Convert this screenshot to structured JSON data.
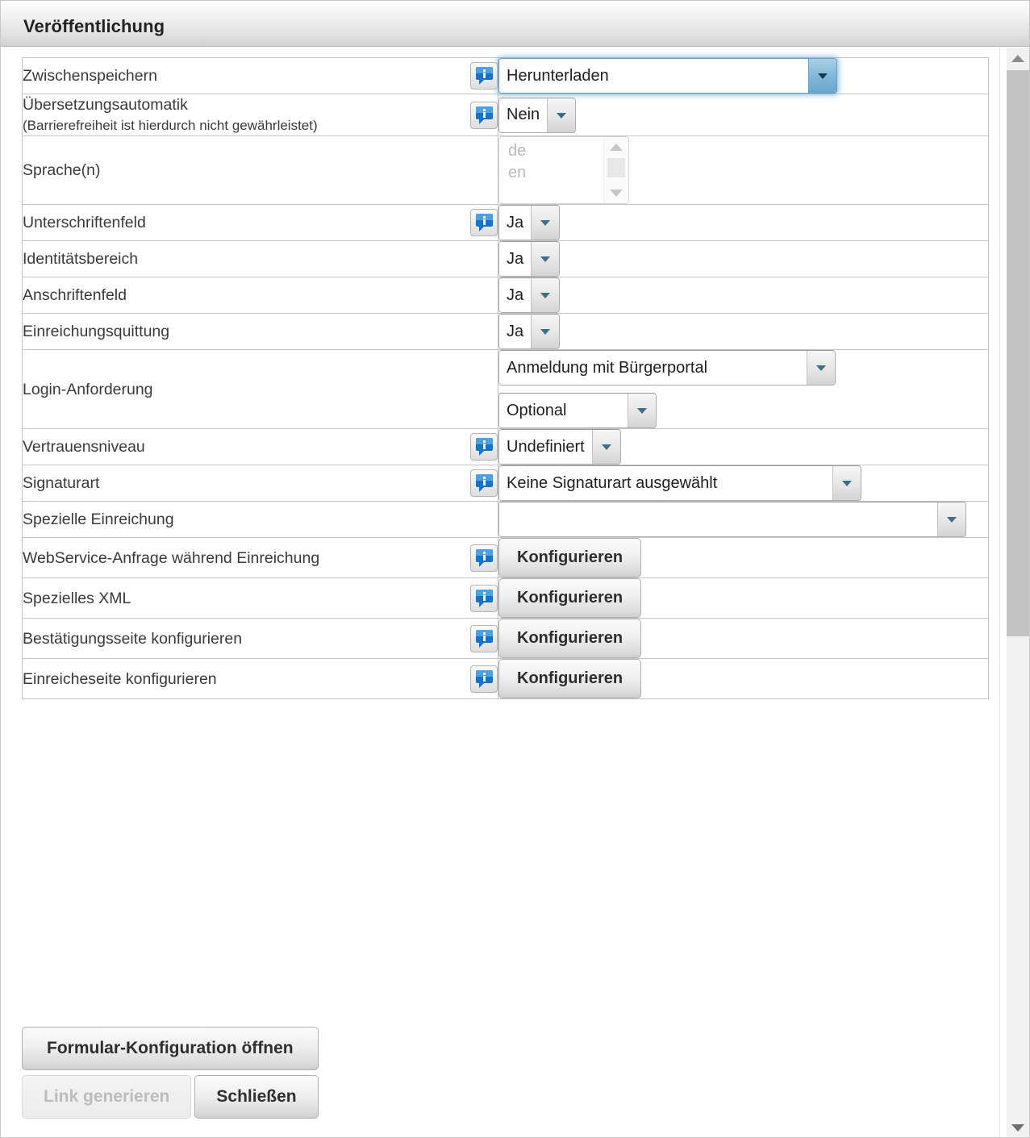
{
  "window": {
    "title": "Veröffentlichung"
  },
  "rows": [
    {
      "label": "Zwischenspeichern",
      "sublabel": "",
      "has_info": true,
      "control": "select",
      "value": "Herunterladen",
      "focused": true
    },
    {
      "label": "Übersetzungsautomatik",
      "sublabel": "(Barrierefreiheit ist hierdurch nicht gewährleistet)",
      "has_info": true,
      "control": "select",
      "value": "Nein",
      "focused": false
    },
    {
      "label": "Sprache(n)",
      "sublabel": "",
      "has_info": false,
      "control": "listbox",
      "options": [
        "de",
        "en"
      ]
    },
    {
      "label": "Unterschriftenfeld",
      "sublabel": "",
      "has_info": true,
      "control": "select",
      "value": "Ja",
      "focused": false
    },
    {
      "label": "Identitätsbereich",
      "sublabel": "",
      "has_info": false,
      "control": "select",
      "value": "Ja",
      "focused": false
    },
    {
      "label": "Anschriftenfeld",
      "sublabel": "",
      "has_info": false,
      "control": "select",
      "value": "Ja",
      "focused": false
    },
    {
      "label": "Einreichungsquittung",
      "sublabel": "",
      "has_info": false,
      "control": "select",
      "value": "Ja",
      "focused": false
    },
    {
      "label": "Login-Anforderung",
      "sublabel": "",
      "has_info": false,
      "control": "select-pair",
      "value": "Anmeldung mit Bürgerportal",
      "value2": "Optional"
    },
    {
      "label": "Vertrauensniveau",
      "sublabel": "",
      "has_info": true,
      "control": "select",
      "value": "Undefiniert",
      "focused": false
    },
    {
      "label": "Signaturart",
      "sublabel": "",
      "has_info": true,
      "control": "select",
      "value": "Keine Signaturart ausgewählt",
      "focused": false
    },
    {
      "label": "Spezielle Einreichung",
      "sublabel": "",
      "has_info": false,
      "control": "select",
      "value": "",
      "focused": false
    },
    {
      "label": "WebService-Anfrage während Einreichung",
      "sublabel": "",
      "has_info": true,
      "control": "button",
      "value": "Konfigurieren"
    },
    {
      "label": "Spezielles XML",
      "sublabel": "",
      "has_info": true,
      "control": "button",
      "value": "Konfigurieren"
    },
    {
      "label": "Bestätigungsseite konfigurieren",
      "sublabel": "",
      "has_info": true,
      "control": "button",
      "value": "Konfigurieren"
    },
    {
      "label": "Einreicheseite konfigurieren",
      "sublabel": "",
      "has_info": true,
      "control": "button",
      "value": "Konfigurieren"
    }
  ],
  "footer": {
    "open_config_label": "Formular-Konfiguration öffnen",
    "generate_link_label": "Link generieren",
    "generate_link_disabled": true,
    "close_label": "Schließen"
  },
  "colors": {
    "info_icon_blue": "#1a72c8",
    "select_arrow": "#3f6d86",
    "focus_glow": "#6eafdc",
    "scrollbar_thumb": "#c3c3c3"
  }
}
